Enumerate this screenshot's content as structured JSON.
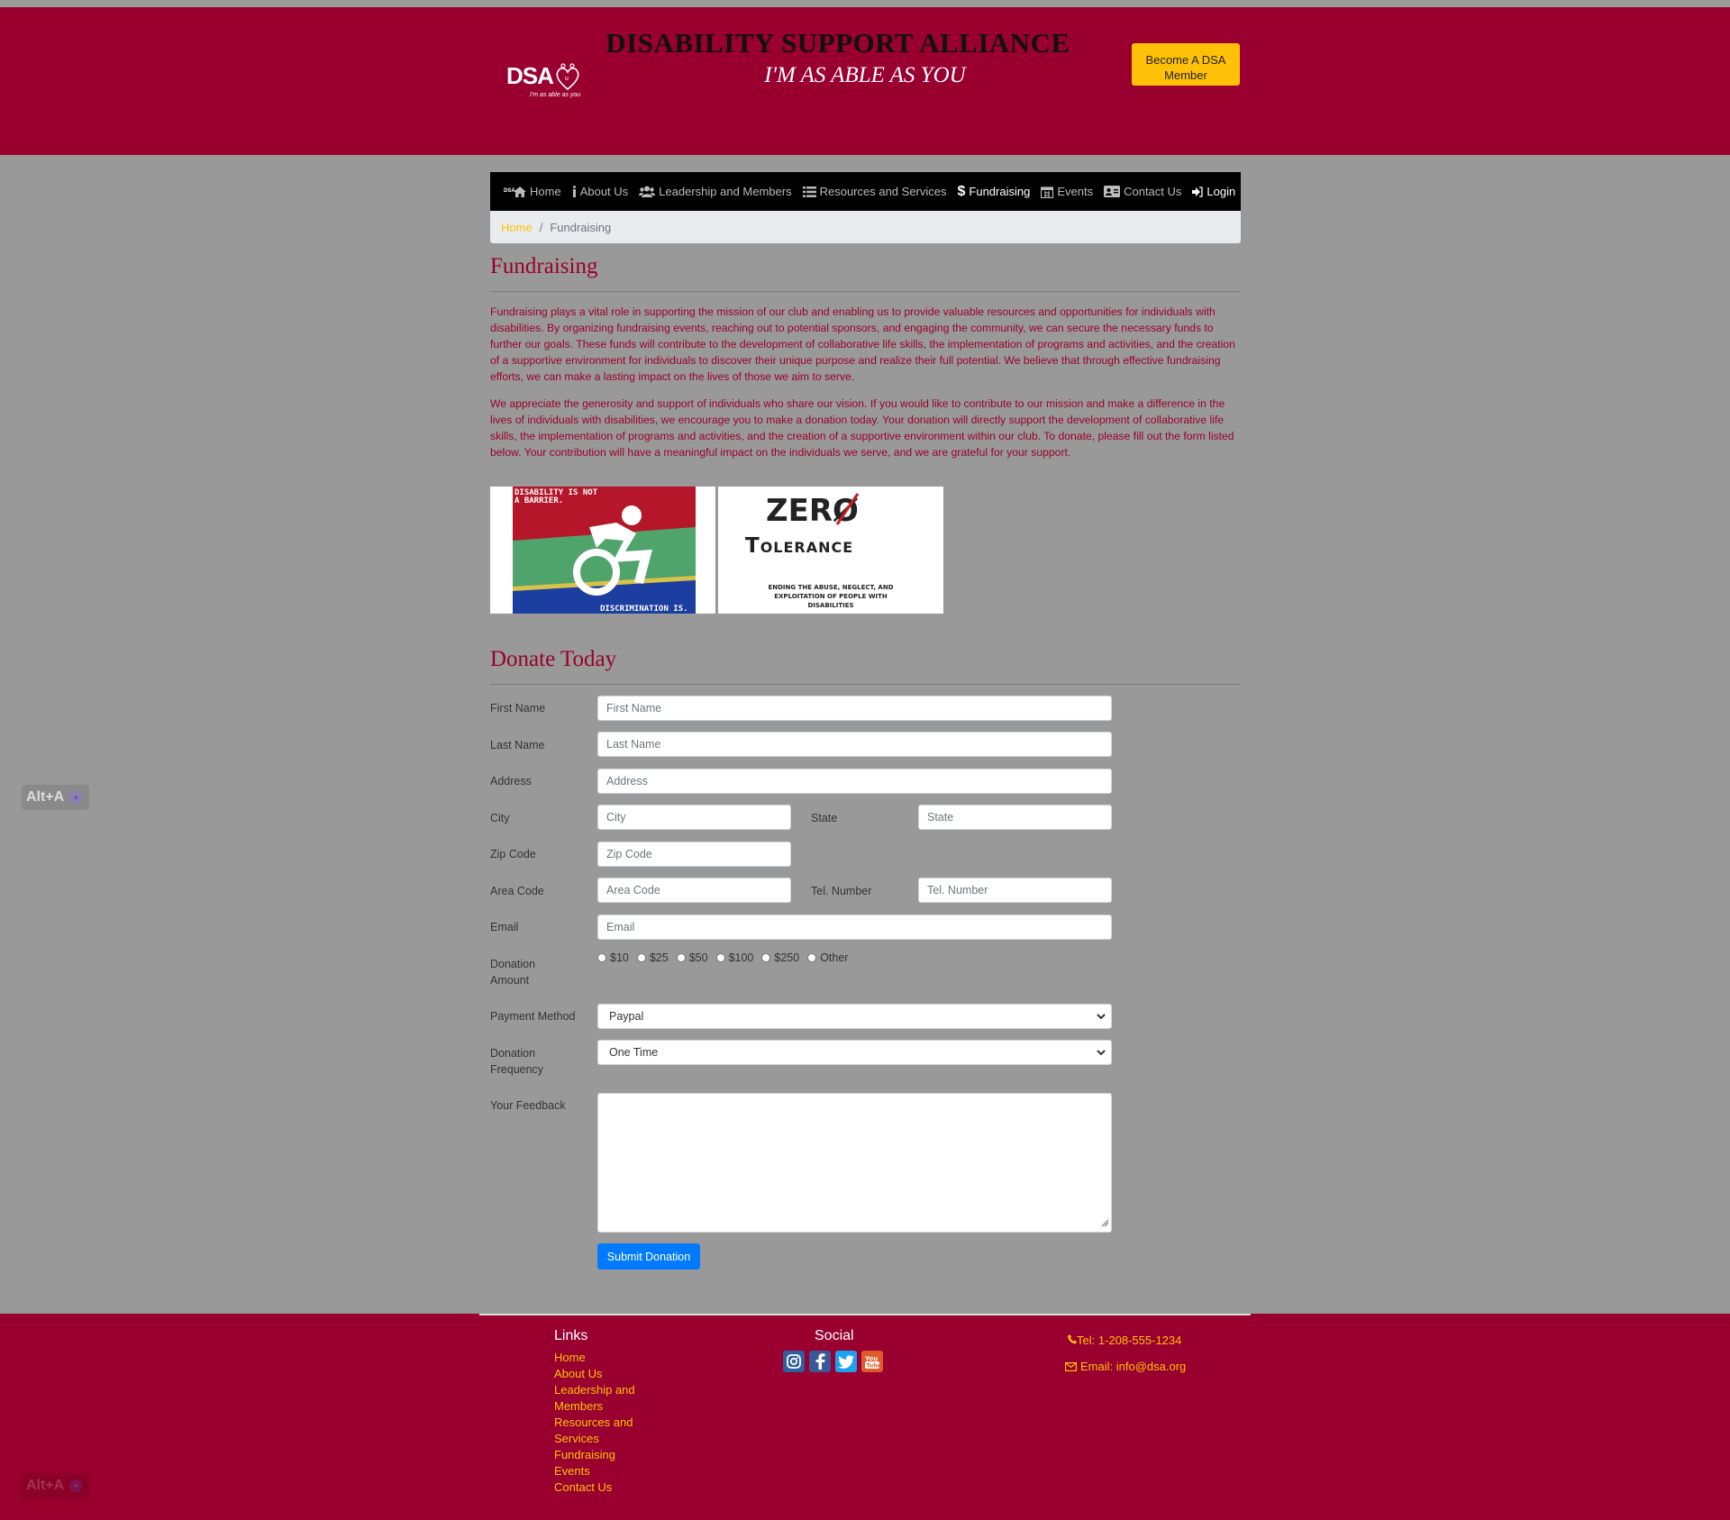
{
  "header": {
    "logo_text": "DSA",
    "logo_tagline": "I'm as able as you",
    "title": "DISABILITY SUPPORT ALLIANCE",
    "subtitle": "I'M AS ABLE AS YOU",
    "member_button": "Become A DSA Member",
    "accent_color": "#99002f",
    "button_color": "#ffc107"
  },
  "nav": {
    "logo_text": "DSA",
    "items": [
      {
        "label": "Home",
        "icon": "home-icon"
      },
      {
        "label": "About Us",
        "icon": "info-icon"
      },
      {
        "label": "Leadership and Members",
        "icon": "users-icon"
      },
      {
        "label": "Resources and Services",
        "icon": "list-icon"
      },
      {
        "label": "Fundraising",
        "icon": "dollar-icon"
      },
      {
        "label": "Events",
        "icon": "calendar-icon"
      },
      {
        "label": "Contact Us",
        "icon": "contact-card-icon"
      },
      {
        "label": "Login",
        "icon": "sign-in-icon"
      }
    ],
    "active": "Fundraising"
  },
  "breadcrumb": {
    "home": "Home",
    "separator": "/",
    "current": "Fundraising"
  },
  "page": {
    "title": "Fundraising",
    "paragraph1": "Fundraising plays a vital role in supporting the mission of our club and enabling us to provide valuable resources and opportunities for individuals with disabilities. By organizing fundraising events, reaching out to potential sponsors, and engaging the community, we can secure the necessary funds to further our goals. These funds will contribute to the development of collaborative life skills, the implementation of programs and activities, and the creation of a supportive environment for individuals to discover their unique purpose and realize their full potential. We believe that through effective fundraising efforts, we can make a lasting impact on the lives of those we aim to serve.",
    "paragraph2": "We appreciate the generosity and support of individuals who share our vision. If you would like to contribute to our mission and make a difference in the lives of individuals with disabilities, we encourage you to make a donation today. Your donation will directly support the development of collaborative life skills, the implementation of programs and activities, and the creation of a supportive environment within our club. To donate, please fill out the form listed below. Your contribution will have a meaningful impact on the individuals we serve, and we are grateful for your support.",
    "image1": {
      "line1": "DISABILITY IS NOT",
      "line2": "A BARRIER.",
      "line3": "DISCRIMINATION IS."
    },
    "image2": {
      "zero": "ZERØ",
      "tolerance": "Tolerance",
      "line1": "ENDING THE ABUSE, NEGLECT, AND",
      "line2": "EXPLOITATION OF PEOPLE WITH",
      "line3": "DISABILITIES"
    }
  },
  "form": {
    "title": "Donate Today",
    "first_name": {
      "label": "First Name",
      "placeholder": "First Name",
      "value": ""
    },
    "last_name": {
      "label": "Last Name",
      "placeholder": "Last Name",
      "value": ""
    },
    "address": {
      "label": "Address",
      "placeholder": "Address",
      "value": ""
    },
    "city": {
      "label": "City",
      "placeholder": "City",
      "value": ""
    },
    "state": {
      "label": "State",
      "placeholder": "State",
      "value": ""
    },
    "zip": {
      "label": "Zip Code",
      "placeholder": "Zip Code",
      "value": ""
    },
    "area_code": {
      "label": "Area Code",
      "placeholder": "Area Code",
      "value": ""
    },
    "tel": {
      "label": "Tel. Number",
      "placeholder": "Tel. Number",
      "value": ""
    },
    "email": {
      "label": "Email",
      "placeholder": "Email",
      "value": ""
    },
    "donation_amount": {
      "label": "Donation Amount",
      "options": [
        "$10",
        "$25",
        "$50",
        "$100",
        "$250",
        "Other"
      ],
      "selected": null
    },
    "payment_method": {
      "label": "Payment Method",
      "selected": "Paypal"
    },
    "donation_frequency": {
      "label": "Donation Frequency",
      "selected": "One Time"
    },
    "feedback": {
      "label": "Your Feedback",
      "value": ""
    },
    "submit": "Submit Donation"
  },
  "footer": {
    "links_title": "Links",
    "links": [
      "Home",
      "About Us",
      "Leadership and Members",
      "Resources and Services",
      "Fundraising",
      "Events",
      "Contact Us"
    ],
    "social_title": "Social",
    "social": [
      "instagram-icon",
      "facebook-icon",
      "twitter-icon",
      "youtube-icon"
    ],
    "tel": "Tel: 1-208-555-1234",
    "email": "Email: info@dsa.org"
  },
  "overlay": {
    "shortcut": "Alt+A"
  }
}
